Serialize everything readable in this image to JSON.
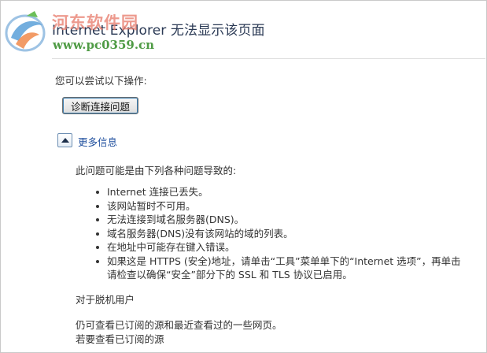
{
  "page": {
    "title": "Internet Explorer 无法显示该页面"
  },
  "watermark": {
    "text": "河东软件园",
    "url": "www.pc0359.cn",
    "icon": "hedong-logo"
  },
  "main": {
    "hint": "您可以尝试以下操作:",
    "diagnose_button": "诊断连接问题",
    "more_info": {
      "toggle_icon": "collapse-up-arrow-icon",
      "label": "更多信息",
      "expanded": true
    },
    "causes_intro": "此问题可能是由下列各种问题导致的:",
    "causes": [
      "Internet 连接已丢失。",
      "该网站暂时不可用。",
      "无法连接到域名服务器(DNS)。",
      "域名服务器(DNS)没有该网站的域的列表。",
      "在地址中可能存在键入错误。",
      "如果这是 HTTPS (安全)地址，请单击“工具”菜单单下的“Internet 选项”，再单击"
    ],
    "causes_continuation": "请检查以确保“安全”部分下的 SSL 和 TLS 协议已启用。",
    "offline": {
      "title": "对于脱机用户",
      "line1": "仍可查看已订阅的源和最近查看过的一些网页。",
      "line2": "若要查看已订阅的源"
    }
  },
  "colors": {
    "link": "#1f4f9e",
    "title": "#2b3a55",
    "watermark_red": "#e87e6f",
    "watermark_green": "#4f9b45"
  }
}
